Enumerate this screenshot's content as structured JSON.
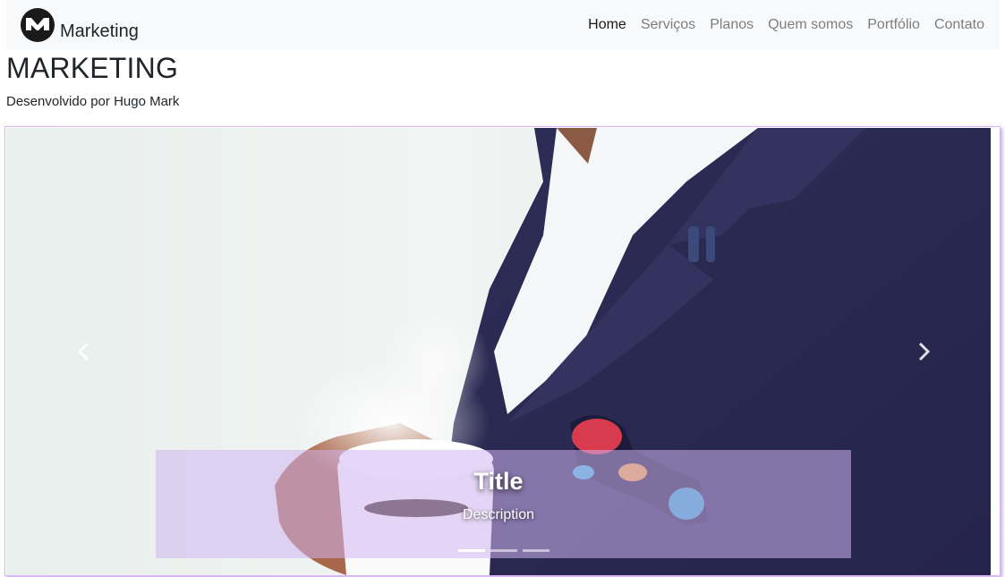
{
  "navbar": {
    "brand_text": "Marketing",
    "logo_icon": "m-logo-icon",
    "links": [
      {
        "label": "Home",
        "active": true
      },
      {
        "label": "Serviços",
        "active": false
      },
      {
        "label": "Planos",
        "active": false
      },
      {
        "label": "Quem somos",
        "active": false
      },
      {
        "label": "Portfólio",
        "active": false
      },
      {
        "label": "Contato",
        "active": false
      }
    ]
  },
  "header": {
    "title": "MARKETING",
    "subtitle": "Desenvolvido por Hugo Mark"
  },
  "carousel": {
    "caption_title": "Title",
    "caption_description": "Description",
    "prev_icon": "chevron-left-icon",
    "next_icon": "chevron-right-icon",
    "slide_count": 3,
    "active_slide": 1
  },
  "colors": {
    "navbar_bg": "#f8f9fa",
    "accent_border": "#b57cf0",
    "caption_overlay": "#d2b4f0",
    "suit": "#2a2a52"
  }
}
